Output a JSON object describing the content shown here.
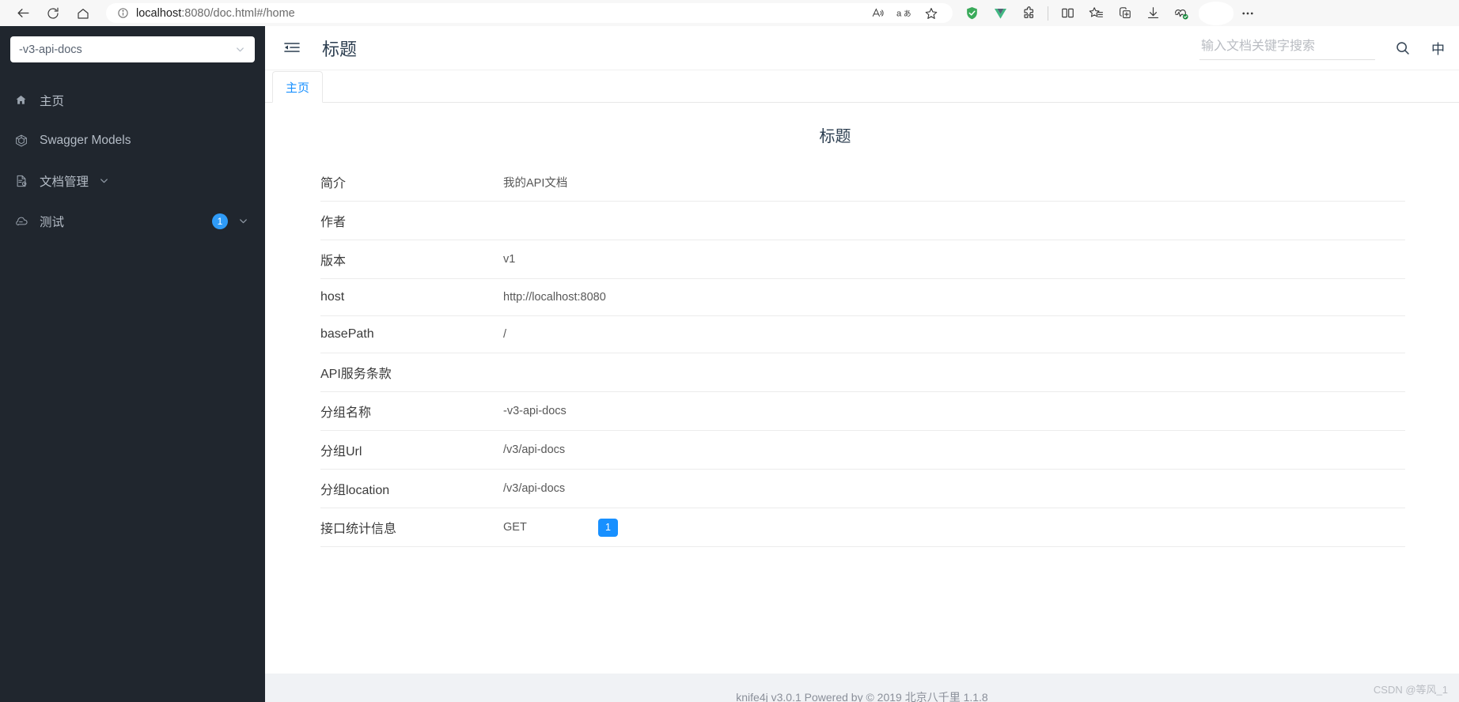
{
  "browser": {
    "url_prefix": "localhost",
    "url_rest": ":8080/doc.html#/home",
    "back_icon": "back-arrow-icon",
    "reload_icon": "reload-icon",
    "home_icon": "home-icon",
    "info_icon": "info-circle-icon",
    "read_aloud_icon": "read-aloud-icon",
    "translate_icon": "translate-icon",
    "favorite_icon": "star-icon",
    "shield_icon": "adblock-shield-icon",
    "vue_icon": "vue-devtools-icon",
    "extensions_icon": "extensions-puzzle-icon",
    "split_screen_icon": "split-screen-icon",
    "collections_icon": "collections-star-icon",
    "add_tab_icon": "browser-essentials-icon",
    "downloads_icon": "downloads-icon",
    "performance_icon": "browser-performance-icon",
    "profile_icon": "profile-avatar-icon",
    "more_icon": "more-options-icon"
  },
  "sidebar": {
    "group_select": {
      "value": "-v3-api-docs",
      "chevron_icon": "chevron-down-icon"
    },
    "items": [
      {
        "label": "主页",
        "icon": "home-icon",
        "badge": null,
        "chevron": false
      },
      {
        "label": "Swagger Models",
        "icon": "cube-icon",
        "badge": null,
        "chevron": false
      },
      {
        "label": "文档管理",
        "icon": "document-settings-icon",
        "badge": null,
        "chevron": true
      },
      {
        "label": "测试",
        "icon": "cloud-icon",
        "badge": "1",
        "chevron": true
      }
    ]
  },
  "topbar": {
    "fold_icon": "menu-fold-icon",
    "title": "标题",
    "search_placeholder": "输入文档关键字搜索",
    "search_value": "",
    "search_icon": "search-icon",
    "lang_toggle": "中"
  },
  "tabs": [
    {
      "label": "主页",
      "active": true
    }
  ],
  "document": {
    "title": "标题",
    "rows": [
      {
        "key": "简介",
        "value": "我的API文档"
      },
      {
        "key": "作者",
        "value": ""
      },
      {
        "key": "版本",
        "value": "v1"
      },
      {
        "key": "host",
        "value": "http://localhost:8080"
      },
      {
        "key": "basePath",
        "value": "/"
      },
      {
        "key": "API服务条款",
        "value": ""
      },
      {
        "key": "分组名称",
        "value": "-v3-api-docs"
      },
      {
        "key": "分组Url",
        "value": "/v3/api-docs"
      },
      {
        "key": "分组location",
        "value": "/v3/api-docs"
      }
    ],
    "stats_row": {
      "key": "接口统计信息",
      "method": "GET",
      "count": "1"
    }
  },
  "footer": {
    "text": "knife4j  v3.0.1  Powered by  © 2019 北京八千里 1.1.8",
    "watermark": "CSDN @等风_1"
  }
}
